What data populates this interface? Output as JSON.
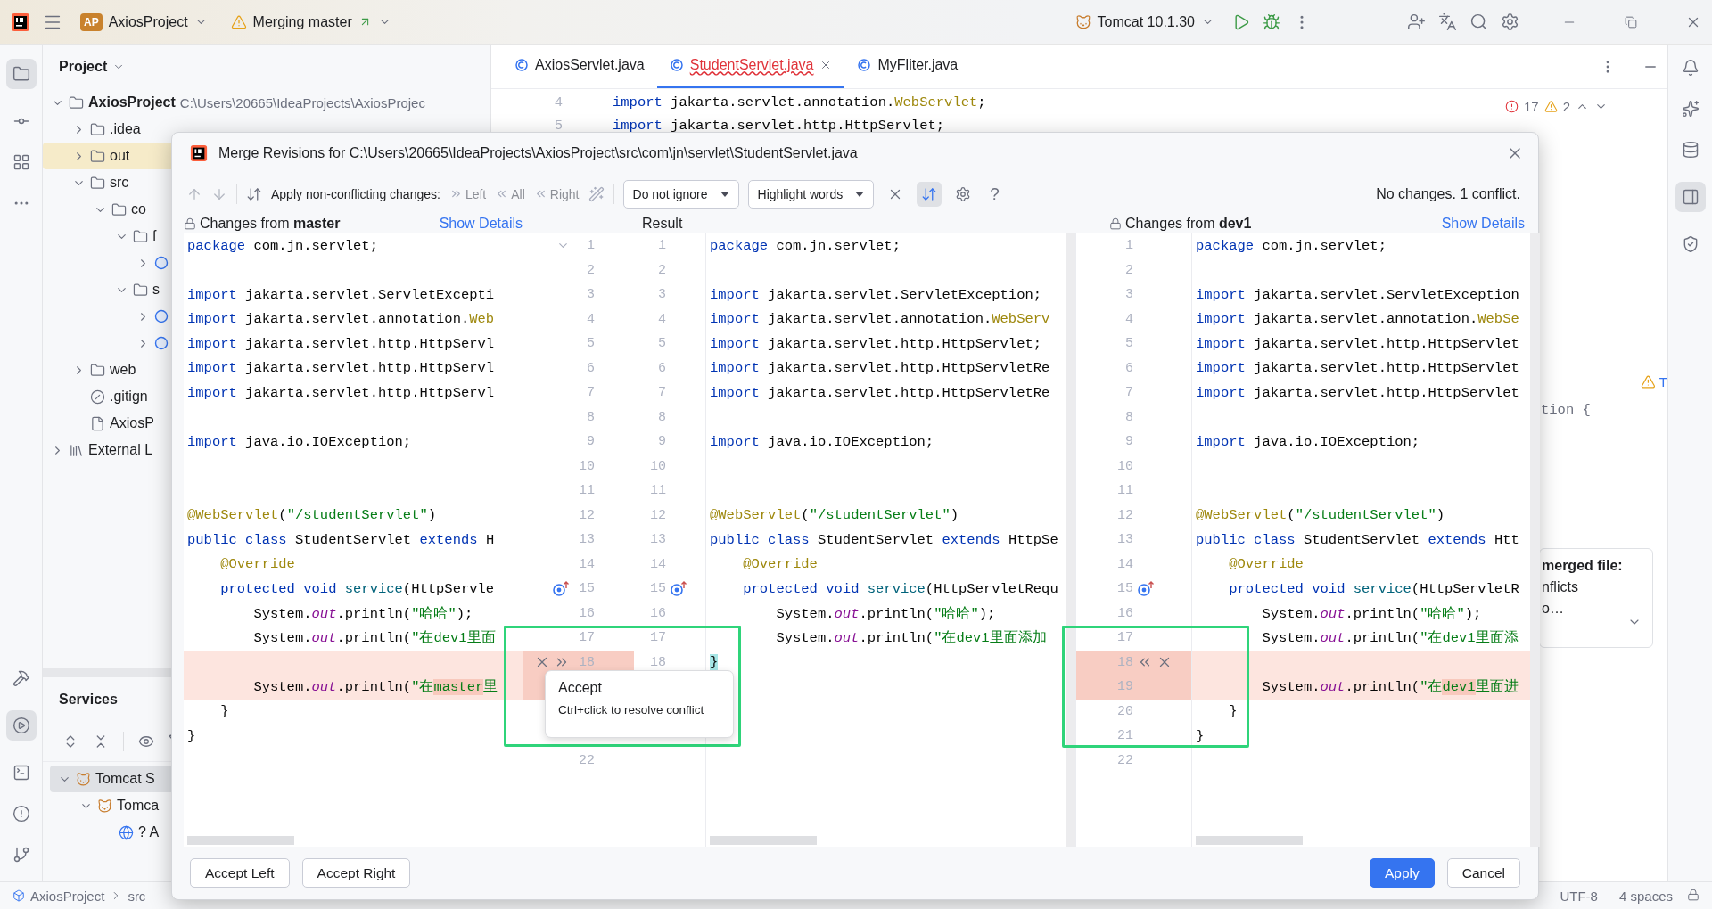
{
  "title_bar": {
    "project_badge": "AP",
    "project": "AxiosProject",
    "branch": "Merging master",
    "run_config": "Tomcat 10.1.30"
  },
  "project_panel": {
    "title": "Project",
    "tree": [
      {
        "label": "AxiosProject",
        "path": "C:\\Users\\20665\\IdeaProjects\\AxiosProjec",
        "kind": "module",
        "expanded": true,
        "highlighted": false,
        "children": [
          {
            "label": ".idea",
            "kind": "folder",
            "expanded": false,
            "highlighted": false
          },
          {
            "label": "out",
            "kind": "folder",
            "expanded": false,
            "highlighted": true
          },
          {
            "label": "src",
            "kind": "folder",
            "expanded": true,
            "highlighted": false,
            "children": [
              {
                "label": "co",
                "kind": "package",
                "expanded": true,
                "highlighted": false,
                "children": [
                  {
                    "label": "f",
                    "kind": "package",
                    "expanded": true,
                    "highlighted": false,
                    "children": [
                      {
                        "kind": "class",
                        "expanded": false,
                        "highlighted": false
                      }
                    ]
                  },
                  {
                    "label": "s",
                    "kind": "package",
                    "expanded": true,
                    "highlighted": false,
                    "children": [
                      {
                        "kind": "class",
                        "expanded": false,
                        "highlighted": false
                      },
                      {
                        "kind": "class",
                        "expanded": false,
                        "highlighted": false
                      }
                    ]
                  }
                ]
              }
            ]
          },
          {
            "label": "web",
            "kind": "folder",
            "expanded": false,
            "highlighted": false
          },
          {
            "label": ".gitign",
            "kind": "ignored",
            "highlighted": false
          },
          {
            "label": "AxiosP",
            "kind": "file",
            "highlighted": false
          }
        ]
      },
      {
        "label": "External L",
        "kind": "library",
        "expanded": false,
        "highlighted": false
      }
    ]
  },
  "services_panel": {
    "title": "Services",
    "tree": [
      {
        "label": "Tomcat S",
        "kind": "server",
        "expanded": true,
        "selected": true,
        "children": [
          {
            "label": "Tomca",
            "kind": "server",
            "expanded": true,
            "selected": false,
            "children": [
              {
                "label": "? A",
                "kind": "artifact",
                "selected": false
              }
            ]
          }
        ]
      }
    ]
  },
  "editor": {
    "tabs": [
      {
        "label": "AxiosServlet.java",
        "selected": false,
        "error": false
      },
      {
        "label": "StudentServlet.java",
        "selected": true,
        "error": true
      },
      {
        "label": "MyFliter.java",
        "selected": false,
        "error": false
      }
    ],
    "lines": [
      {
        "number": "4",
        "segments": [
          {
            "text": "import",
            "kind": "keyword"
          },
          {
            "text": " jakarta.servlet.annotation."
          },
          {
            "text": "WebServlet",
            "kind": "annotation"
          },
          {
            "text": ";"
          }
        ]
      },
      {
        "number": "5",
        "segments": [
          {
            "text": "import",
            "kind": "keyword"
          },
          {
            "text": " jakarta.servlet.http.HttpServlet;"
          }
        ]
      }
    ],
    "errors": "17",
    "warnings": "2",
    "fragment": "tion {",
    "warning_fragment": "T",
    "notification": {
      "title": "merged file:",
      "text": "nflicts",
      "more": "o…"
    }
  },
  "merge_dialog": {
    "title": "Merge Revisions for C:\\Users\\20665\\IdeaProjects\\AxiosProject\\src\\com\\jn\\servlet\\StudentServlet.java",
    "apply_label": "Apply non-conflicting changes:",
    "apply_actions": [
      {
        "label": "Left",
        "kind": "left",
        "disabled": true
      },
      {
        "label": "All",
        "kind": "all",
        "disabled": true
      },
      {
        "label": "Right",
        "kind": "right",
        "disabled": true
      }
    ],
    "dropdowns": [
      "Do not ignore",
      "Highlight words"
    ],
    "help": "?",
    "status": "No changes. 1 conflict.",
    "left_header": "Changes from **master**",
    "left_show_details": "Show Details",
    "result_header": "Result",
    "right_header": "Changes from **dev1**",
    "right_show_details": "Show Details",
    "left": [
      {
        "number": "1",
        "marker": {
          "kind": "fold"
        },
        "conflict": false,
        "segments": [
          {
            "text": "package",
            "kind": "keyword"
          },
          {
            "text": " com.jn.servlet;"
          }
        ]
      },
      {
        "number": "2",
        "conflict": false
      },
      {
        "number": "3",
        "conflict": false,
        "segments": [
          {
            "text": "import",
            "kind": "keyword"
          },
          {
            "text": " jakarta.servlet.ServletExcepti"
          }
        ]
      },
      {
        "number": "4",
        "conflict": false,
        "segments": [
          {
            "text": "import",
            "kind": "keyword"
          },
          {
            "text": " jakarta.servlet.annotation."
          },
          {
            "text": "Web",
            "kind": "annotation"
          }
        ]
      },
      {
        "number": "5",
        "conflict": false,
        "segments": [
          {
            "text": "import",
            "kind": "keyword"
          },
          {
            "text": " jakarta.servlet.http.HttpServl"
          }
        ]
      },
      {
        "number": "6",
        "conflict": false,
        "segments": [
          {
            "text": "import",
            "kind": "keyword"
          },
          {
            "text": " jakarta.servlet.http.HttpServl"
          }
        ]
      },
      {
        "number": "7",
        "conflict": false,
        "segments": [
          {
            "text": "import",
            "kind": "keyword"
          },
          {
            "text": " jakarta.servlet.http.HttpServl"
          }
        ]
      },
      {
        "number": "8",
        "conflict": false
      },
      {
        "number": "9",
        "conflict": false,
        "segments": [
          {
            "text": "import",
            "kind": "keyword"
          },
          {
            "text": " java.io.IOException;"
          }
        ]
      },
      {
        "number": "10",
        "conflict": false
      },
      {
        "number": "11",
        "conflict": false
      },
      {
        "number": "12",
        "conflict": false,
        "segments": [
          {
            "text": "@WebServlet",
            "kind": "annotation"
          },
          {
            "text": "("
          },
          {
            "text": "\"/studentServlet\"",
            "kind": "string"
          },
          {
            "text": ")"
          }
        ]
      },
      {
        "number": "13",
        "conflict": false,
        "segments": [
          {
            "text": "public class",
            "kind": "keyword"
          },
          {
            "text": " StudentServlet "
          },
          {
            "text": "extends",
            "kind": "keyword"
          },
          {
            "text": " H"
          }
        ]
      },
      {
        "number": "14",
        "conflict": false,
        "segments": [
          {
            "text": "    @Override",
            "kind": "annotation"
          }
        ]
      },
      {
        "number": "15",
        "marker": {
          "kind": "override"
        },
        "conflict": false,
        "segments": [
          {
            "text": "    protected void",
            "kind": "keyword"
          },
          {
            "text": " service",
            "kind": "method"
          },
          {
            "text": "(HttpServle"
          }
        ]
      },
      {
        "number": "16",
        "conflict": false,
        "segments": [
          {
            "text": "        System."
          },
          {
            "text": "out",
            "kind": "field"
          },
          {
            "text": ".println("
          },
          {
            "text": "\"哈哈\"",
            "kind": "string"
          },
          {
            "text": ");"
          }
        ]
      },
      {
        "number": "17",
        "conflict": false,
        "segments": [
          {
            "text": "        System."
          },
          {
            "text": "out",
            "kind": "field"
          },
          {
            "text": ".println("
          },
          {
            "text": "\"在dev1里面",
            "kind": "string"
          }
        ]
      },
      {
        "number": "18",
        "marker": {
          "kind": "accept"
        },
        "conflict": true
      },
      {
        "conflict": true,
        "segments": [
          {
            "text": "        System."
          },
          {
            "text": "out",
            "kind": "field"
          },
          {
            "text": ".println("
          },
          {
            "text": "\"在",
            "kind": "string"
          },
          {
            "text": "master",
            "kind": "string_changed"
          },
          {
            "text": "里",
            "kind": "string"
          }
        ]
      },
      {
        "conflict": false,
        "segments": [
          {
            "text": "    }"
          }
        ]
      },
      {
        "conflict": false,
        "segments": [
          {
            "text": "}"
          }
        ]
      },
      {
        "number": "22",
        "conflict": false
      }
    ],
    "result": [
      {
        "number": "1",
        "segments": [
          {
            "text": "package",
            "kind": "keyword"
          },
          {
            "text": " com.jn.servlet;"
          }
        ]
      },
      {
        "number": "2"
      },
      {
        "number": "3",
        "segments": [
          {
            "text": "import",
            "kind": "keyword"
          },
          {
            "text": " jakarta.servlet.ServletException;"
          }
        ]
      },
      {
        "number": "4",
        "segments": [
          {
            "text": "import",
            "kind": "keyword"
          },
          {
            "text": " jakarta.servlet.annotation."
          },
          {
            "text": "WebServ",
            "kind": "annotation"
          }
        ]
      },
      {
        "number": "5",
        "segments": [
          {
            "text": "import",
            "kind": "keyword"
          },
          {
            "text": " jakarta.servlet.http.HttpServlet;"
          }
        ]
      },
      {
        "number": "6",
        "segments": [
          {
            "text": "import",
            "kind": "keyword"
          },
          {
            "text": " jakarta.servlet.http.HttpServletRe"
          }
        ]
      },
      {
        "number": "7",
        "segments": [
          {
            "text": "import",
            "kind": "keyword"
          },
          {
            "text": " jakarta.servlet.http.HttpServletRe"
          }
        ]
      },
      {
        "number": "8"
      },
      {
        "number": "9",
        "segments": [
          {
            "text": "import",
            "kind": "keyword"
          },
          {
            "text": " java.io.IOException;"
          }
        ]
      },
      {
        "number": "10"
      },
      {
        "number": "11"
      },
      {
        "number": "12",
        "segments": [
          {
            "text": "@WebServlet",
            "kind": "annotation"
          },
          {
            "text": "("
          },
          {
            "text": "\"/studentServlet\"",
            "kind": "string"
          },
          {
            "text": ")"
          }
        ]
      },
      {
        "number": "13",
        "segments": [
          {
            "text": "public class",
            "kind": "keyword"
          },
          {
            "text": " StudentServlet "
          },
          {
            "text": "extends",
            "kind": "keyword"
          },
          {
            "text": " HttpSe"
          }
        ]
      },
      {
        "number": "14",
        "segments": [
          {
            "text": "    @Override",
            "kind": "annotation"
          }
        ]
      },
      {
        "number": "15",
        "marker": {
          "kind": "override"
        },
        "segments": [
          {
            "text": "    protected void",
            "kind": "keyword"
          },
          {
            "text": " service",
            "kind": "method"
          },
          {
            "text": "(HttpServletRequ"
          }
        ]
      },
      {
        "number": "16",
        "segments": [
          {
            "text": "        System."
          },
          {
            "text": "out",
            "kind": "field"
          },
          {
            "text": ".println("
          },
          {
            "text": "\"哈哈\"",
            "kind": "string"
          },
          {
            "text": ");"
          }
        ]
      },
      {
        "number": "17",
        "segments": [
          {
            "text": "        System."
          },
          {
            "text": "out",
            "kind": "field"
          },
          {
            "text": ".println("
          },
          {
            "text": "\"在dev1里面添加",
            "kind": "string"
          }
        ]
      },
      {
        "number": "18",
        "segments": [
          {
            "text": "}",
            "kind": "bracket"
          }
        ]
      }
    ],
    "right": [
      {
        "number": "1",
        "conflict": false,
        "segments": [
          {
            "text": "package",
            "kind": "keyword"
          },
          {
            "text": " com.jn.servlet;"
          }
        ]
      },
      {
        "number": "2",
        "conflict": false
      },
      {
        "number": "3",
        "conflict": false,
        "segments": [
          {
            "text": "import",
            "kind": "keyword"
          },
          {
            "text": " jakarta.servlet.ServletException"
          }
        ]
      },
      {
        "number": "4",
        "conflict": false,
        "segments": [
          {
            "text": "import",
            "kind": "keyword"
          },
          {
            "text": " jakarta.servlet.annotation."
          },
          {
            "text": "WebSe",
            "kind": "annotation"
          }
        ]
      },
      {
        "number": "5",
        "conflict": false,
        "segments": [
          {
            "text": "import",
            "kind": "keyword"
          },
          {
            "text": " jakarta.servlet.http.HttpServlet"
          }
        ]
      },
      {
        "number": "6",
        "conflict": false,
        "segments": [
          {
            "text": "import",
            "kind": "keyword"
          },
          {
            "text": " jakarta.servlet.http.HttpServlet"
          }
        ]
      },
      {
        "number": "7",
        "conflict": false,
        "segments": [
          {
            "text": "import",
            "kind": "keyword"
          },
          {
            "text": " jakarta.servlet.http.HttpServlet"
          }
        ]
      },
      {
        "number": "8",
        "conflict": false
      },
      {
        "number": "9",
        "conflict": false,
        "segments": [
          {
            "text": "import",
            "kind": "keyword"
          },
          {
            "text": " java.io.IOException;"
          }
        ]
      },
      {
        "number": "10",
        "conflict": false
      },
      {
        "number": "11",
        "conflict": false
      },
      {
        "number": "12",
        "conflict": false,
        "segments": [
          {
            "text": "@WebServlet",
            "kind": "annotation"
          },
          {
            "text": "("
          },
          {
            "text": "\"/studentServlet\"",
            "kind": "string"
          },
          {
            "text": ")"
          }
        ]
      },
      {
        "number": "13",
        "conflict": false,
        "segments": [
          {
            "text": "public class",
            "kind": "keyword"
          },
          {
            "text": " StudentServlet "
          },
          {
            "text": "extends",
            "kind": "keyword"
          },
          {
            "text": " Htt"
          }
        ]
      },
      {
        "number": "14",
        "conflict": false,
        "segments": [
          {
            "text": "    @Override",
            "kind": "annotation"
          }
        ]
      },
      {
        "number": "15",
        "marker": {
          "kind": "override"
        },
        "conflict": false,
        "segments": [
          {
            "text": "    protected void",
            "kind": "keyword"
          },
          {
            "text": " service",
            "kind": "method"
          },
          {
            "text": "(HttpServletR"
          }
        ]
      },
      {
        "number": "16",
        "conflict": false,
        "segments": [
          {
            "text": "        System."
          },
          {
            "text": "out",
            "kind": "field"
          },
          {
            "text": ".println("
          },
          {
            "text": "\"哈哈\"",
            "kind": "string"
          },
          {
            "text": ");"
          }
        ]
      },
      {
        "number": "17",
        "conflict": false,
        "segments": [
          {
            "text": "        System."
          },
          {
            "text": "out",
            "kind": "field"
          },
          {
            "text": ".println("
          },
          {
            "text": "\"在dev1里面添",
            "kind": "string"
          }
        ]
      },
      {
        "number": "18",
        "marker": {
          "kind": "accept"
        },
        "conflict": true
      },
      {
        "number": "19",
        "conflict": true,
        "segments": [
          {
            "text": "        System."
          },
          {
            "text": "out",
            "kind": "field"
          },
          {
            "text": ".println("
          },
          {
            "text": "\"在",
            "kind": "string"
          },
          {
            "text": "dev1",
            "kind": "string_changed"
          },
          {
            "text": "里面进",
            "kind": "string"
          }
        ]
      },
      {
        "number": "20",
        "conflict": false,
        "segments": [
          {
            "text": "    }"
          }
        ]
      },
      {
        "number": "21",
        "conflict": false,
        "segments": [
          {
            "text": "}"
          }
        ]
      },
      {
        "number": "22",
        "conflict": false
      }
    ],
    "popup": {
      "title": "Accept",
      "hint": "Ctrl+click to resolve conflict"
    },
    "highlight_frames": {
      "left": true,
      "right": true
    },
    "buttons": [
      {
        "label": "Accept Left",
        "kind": "secondary"
      },
      {
        "label": "Accept Right",
        "kind": "secondary"
      },
      {
        "label": "Apply",
        "kind": "primary"
      },
      {
        "label": "Cancel",
        "kind": "secondary"
      }
    ]
  },
  "status_bar": {
    "path": [
      "AxiosProject",
      "src"
    ],
    "encoding": "UTF-8",
    "indent": "4 spaces"
  }
}
